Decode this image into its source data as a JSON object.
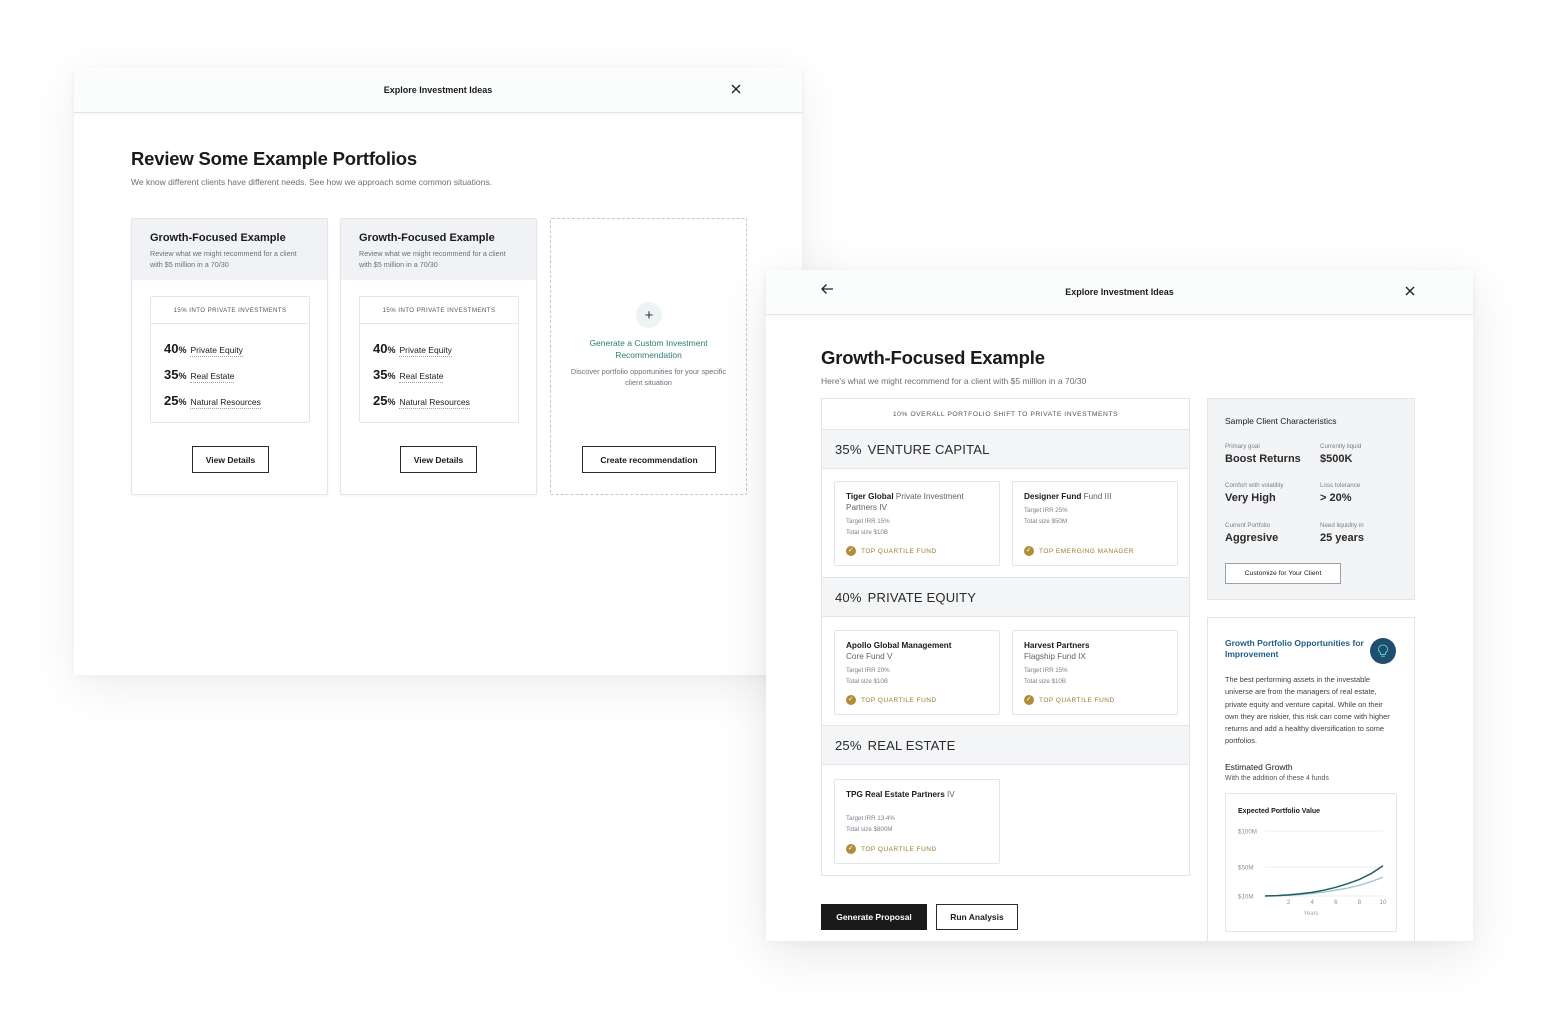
{
  "window1": {
    "title": "Explore Investment Ideas",
    "heading": "Review Some Example Portfolios",
    "subheading": "We know different clients have different needs. See how we approach some common situations.",
    "cards": [
      {
        "title": "Growth-Focused Example",
        "description": "Review what we might recommend for a client with $5 million in a 70/30",
        "alloc_header": "15% INTO PRIVATE INVESTMENTS",
        "allocations": [
          {
            "pct": "40",
            "name": "Private Equity"
          },
          {
            "pct": "35",
            "name": "Real Estate"
          },
          {
            "pct": "25",
            "name": "Natural Resources"
          }
        ],
        "button": "View Details"
      },
      {
        "title": "Growth-Focused Example",
        "description": "Review what we might recommend for a client with $5 million in a 70/30",
        "alloc_header": "15% INTO PRIVATE INVESTMENTS",
        "allocations": [
          {
            "pct": "40",
            "name": "Private Equity"
          },
          {
            "pct": "35",
            "name": "Real Estate"
          },
          {
            "pct": "25",
            "name": "Natural Resources"
          }
        ],
        "button": "View Details"
      }
    ],
    "custom": {
      "plus": "+",
      "title": "Generate a Custom Investment Recommendation",
      "description": "Discover portfolio opportunities for your specific client situation",
      "button": "Create recommendation"
    },
    "pct_symbol": "%"
  },
  "window2": {
    "title": "Explore Investment Ideas",
    "heading": "Growth-Focused Example",
    "subheading": "Here's what we might recommend for a client with $5 million in a 70/30",
    "funds_header": "10% OVERALL PORTFOLIO SHIFT TO PRIVATE INVESTMENTS",
    "sections": [
      {
        "pct": "35%",
        "name": "VENTURE CAPITAL",
        "funds": [
          {
            "name_bold": "Tiger Global",
            "name_light": " Private Investment Partners IV",
            "irr": "Target IRR 15%",
            "size": "Total size $10B",
            "badge": "TOP QUARTILE FUND"
          },
          {
            "name_bold": "Designer Fund",
            "name_light": " Fund III",
            "irr": "Target IRR 25%",
            "size": "Total size $50M",
            "badge": "TOP EMERGING MANAGER"
          }
        ]
      },
      {
        "pct": "40%",
        "name": "PRIVATE EQUITY",
        "funds": [
          {
            "name_bold": "Apollo Global Management",
            "name_light": "Core Fund V",
            "irr": "Target IRR 20%",
            "size": "Total size $10B",
            "badge": "TOP QUARTILE FUND"
          },
          {
            "name_bold": "Harvest Partners",
            "name_light": "Flagship Fund IX",
            "irr": "Target IRR 15%",
            "size": "Total size $10B",
            "badge": "TOP QUARTILE FUND"
          }
        ]
      },
      {
        "pct": "25%",
        "name": "REAL ESTATE",
        "funds": [
          {
            "name_bold": "TPG Real Estate Partners",
            "name_light": " IV",
            "irr": "Target IRR 13.4%",
            "size": "Total size $800M",
            "badge": "TOP QUARTILE FUND"
          }
        ]
      }
    ],
    "buttons": {
      "generate": "Generate Proposal",
      "run": "Run Analysis"
    },
    "client": {
      "title": "Sample Client Characteristics",
      "items": [
        {
          "label": "Primary goal",
          "value": "Boost Returns"
        },
        {
          "label": "Currently liquid",
          "value": "$500K"
        },
        {
          "label": "Comfort with volatility",
          "value": "Very High"
        },
        {
          "label": "Loss tolerance",
          "value": "> 20%"
        },
        {
          "label": "Current Portfolio",
          "value": "Aggresive"
        },
        {
          "label": "Need liquidity in",
          "value": "25 years"
        }
      ],
      "button": "Customize for Your Client"
    },
    "opportunities": {
      "title": "Growth Portfolio Opportunities for Improvement",
      "text": "The best performing assets in the investable universe are from the managers of real estate, private equity and venture capital. While on their own they are riskier, this risk can come with higher returns and add a healthy diversification to some portfolios.",
      "growth_title": "Estimated Growth",
      "growth_sub": "With the addition of these 4 funds"
    },
    "colors": {
      "accent_teal": "#2a7d70",
      "link_blue": "#1f5c86",
      "badge_gold": "#b08d3a",
      "series_dark": "#1f5f5b",
      "series_light": "#9cc4cc"
    }
  },
  "chart_data": {
    "type": "line",
    "title": "Expected Portfolio Value",
    "xlabel": "Years",
    "ylabel": "",
    "x_ticks": [
      2,
      4,
      6,
      8,
      10
    ],
    "y_ticks": [
      10,
      50,
      100
    ],
    "y_tick_labels": [
      "$10M",
      "$50M",
      "$100M"
    ],
    "xlim": [
      0,
      10
    ],
    "ylim": [
      10,
      100
    ],
    "x": [
      0,
      1,
      2,
      3,
      4,
      5,
      6,
      7,
      8,
      9,
      10
    ],
    "series": [
      {
        "values": [
          10,
          10.5,
          11.5,
          13,
          15,
          18,
          22,
          27,
          33,
          41,
          52
        ],
        "color": "#1f5f5b"
      },
      {
        "values": [
          10,
          10.3,
          11,
          12,
          13.5,
          15.5,
          18,
          21,
          25,
          30,
          36
        ],
        "color": "#9cc4cc"
      }
    ],
    "grid": true,
    "legend": "none"
  }
}
